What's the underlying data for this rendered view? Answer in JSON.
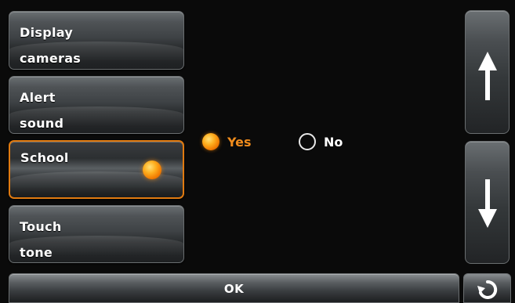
{
  "menu": {
    "items": [
      {
        "label": "Display\ncameras"
      },
      {
        "label": "Alert\nsound"
      },
      {
        "label": "School"
      },
      {
        "label": "Touch\ntone"
      }
    ]
  },
  "options": {
    "yes_label": "Yes",
    "no_label": "No",
    "selected": "Yes"
  },
  "footer": {
    "ok_label": "OK"
  },
  "colors": {
    "accent": "#f08c1c",
    "background": "#0a0a0a",
    "button_text": "#ffffff"
  },
  "icons": [
    "up-arrow-icon",
    "down-arrow-icon",
    "back-icon",
    "radio-selected-icon",
    "radio-unselected-icon"
  ]
}
